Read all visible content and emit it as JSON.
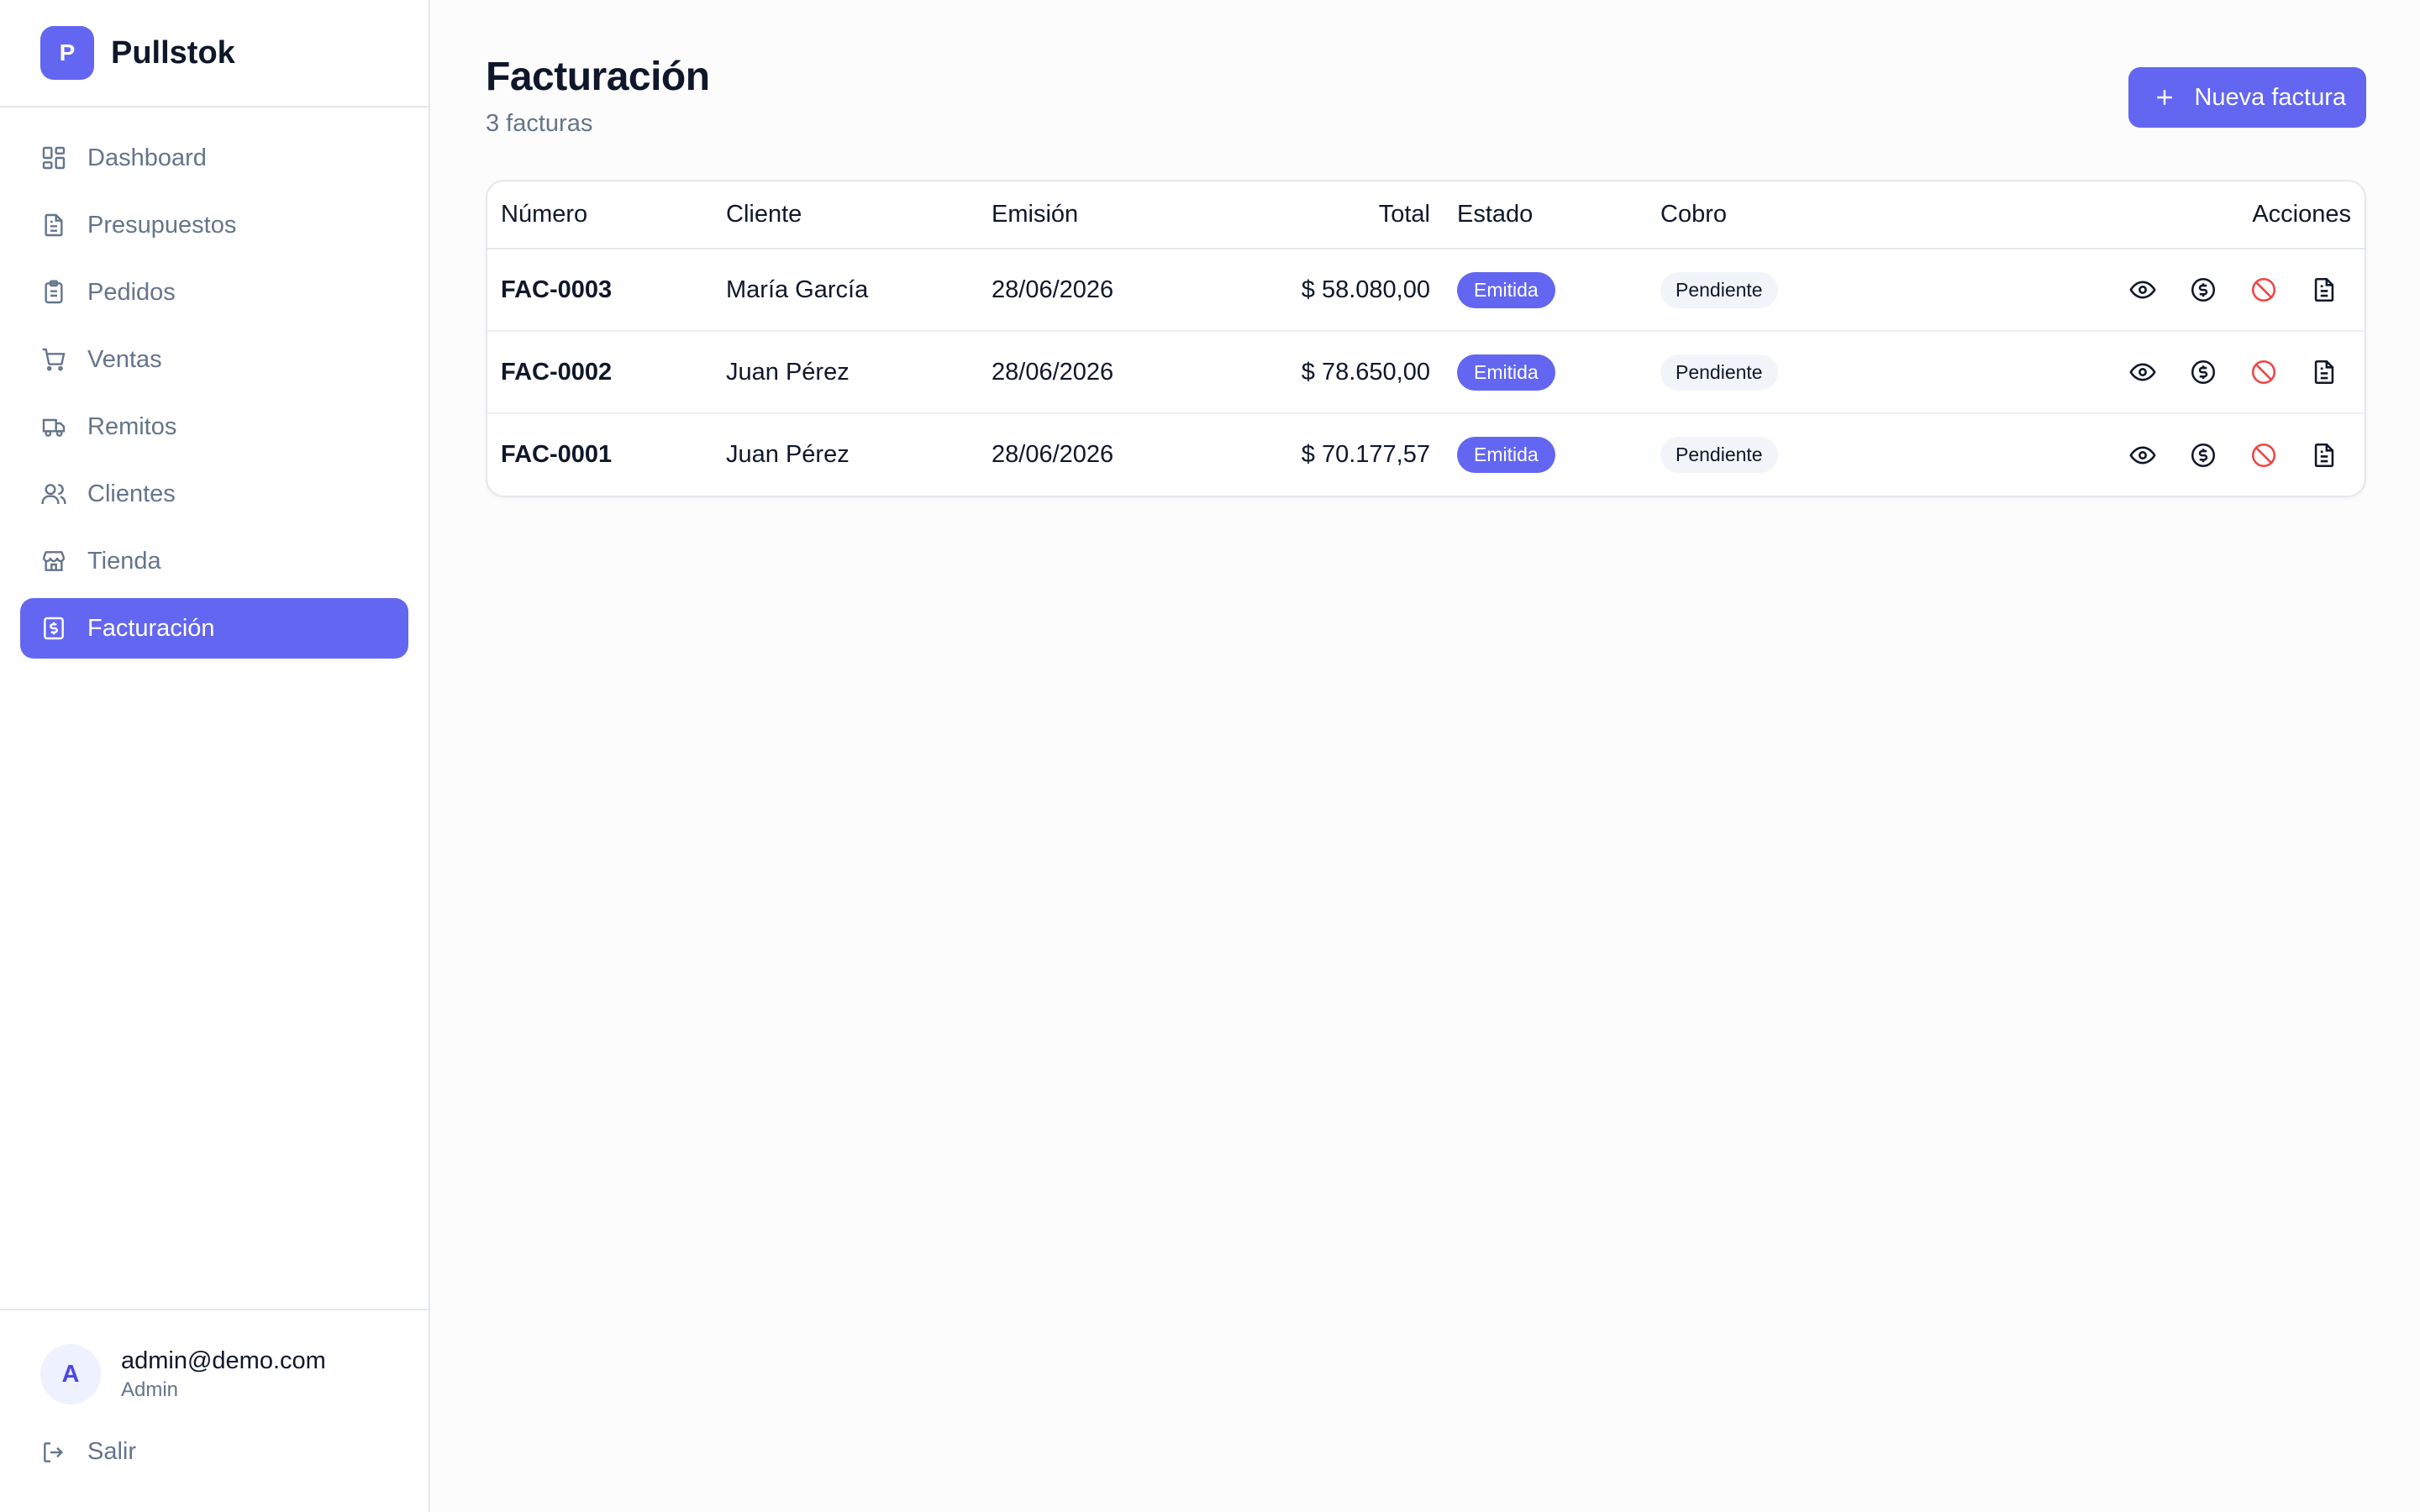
{
  "brand": {
    "initial": "P",
    "name": "Pullstok"
  },
  "sidebar": {
    "items": [
      {
        "label": "Dashboard",
        "icon": "dashboard-icon"
      },
      {
        "label": "Presupuestos",
        "icon": "document-icon"
      },
      {
        "label": "Pedidos",
        "icon": "clipboard-icon"
      },
      {
        "label": "Ventas",
        "icon": "cart-icon"
      },
      {
        "label": "Remitos",
        "icon": "truck-icon"
      },
      {
        "label": "Clientes",
        "icon": "users-icon"
      },
      {
        "label": "Tienda",
        "icon": "store-icon"
      },
      {
        "label": "Facturación",
        "icon": "receipt-dollar-icon",
        "active": true
      }
    ]
  },
  "user": {
    "initial": "A",
    "email": "admin@demo.com",
    "role": "Admin"
  },
  "logout": {
    "label": "Salir"
  },
  "page": {
    "title": "Facturación",
    "subtitle": "3 facturas",
    "new_button": "Nueva factura"
  },
  "table": {
    "headers": {
      "numero": "Número",
      "cliente": "Cliente",
      "emision": "Emisión",
      "total": "Total",
      "estado": "Estado",
      "cobro": "Cobro",
      "acciones": "Acciones"
    },
    "rows": [
      {
        "numero": "FAC-0003",
        "cliente": "María García",
        "emision": "28/06/2026",
        "total": "$ 58.080,00",
        "estado": "Emitida",
        "cobro": "Pendiente"
      },
      {
        "numero": "FAC-0002",
        "cliente": "Juan Pérez",
        "emision": "28/06/2026",
        "total": "$ 78.650,00",
        "estado": "Emitida",
        "cobro": "Pendiente"
      },
      {
        "numero": "FAC-0001",
        "cliente": "Juan Pérez",
        "emision": "28/06/2026",
        "total": "$ 70.177,57",
        "estado": "Emitida",
        "cobro": "Pendiente"
      }
    ]
  },
  "colors": {
    "accent": "#6366f1",
    "danger": "#ef4444",
    "muted": "#64748b"
  }
}
